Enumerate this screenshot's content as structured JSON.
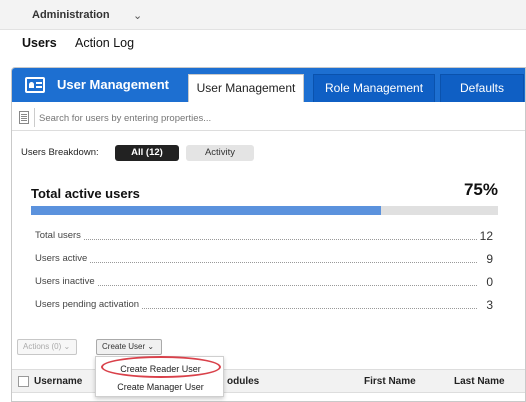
{
  "topbar": {
    "admin_label": "Administration",
    "chevron_icon": "chevron-down-icon"
  },
  "subnav": {
    "users_label": "Users",
    "action_log_label": "Action Log"
  },
  "panel": {
    "title": "User Management",
    "icon": "user-card-icon",
    "accent_color": "#1d6fd1",
    "tabs": [
      {
        "label": "User Management",
        "active": true
      },
      {
        "label": "Role Management",
        "active": false
      },
      {
        "label": "Defaults",
        "active": false
      }
    ]
  },
  "search": {
    "placeholder": "Search for users by entering properties...",
    "value": ""
  },
  "breakdown": {
    "label": "Users Breakdown:",
    "all_label": "All  (12)",
    "activity_label": "Activity"
  },
  "stats": {
    "title": "Total active users",
    "percent_label": "75%",
    "progress_fraction": 0.75,
    "rows": [
      {
        "label": "Total users",
        "value": "12"
      },
      {
        "label": "Users active",
        "value": "9"
      },
      {
        "label": "Users inactive",
        "value": "0"
      },
      {
        "label": "Users pending activation",
        "value": "3"
      }
    ]
  },
  "actions": {
    "actions_button": "Actions (0)",
    "create_user_button": "Create User"
  },
  "dropdown": {
    "items": [
      "Create Reader User",
      "Create Manager User"
    ],
    "highlight_color": "#d9414a"
  },
  "table": {
    "headers": [
      "Username",
      "odules",
      "First Name",
      "Last Name"
    ]
  }
}
